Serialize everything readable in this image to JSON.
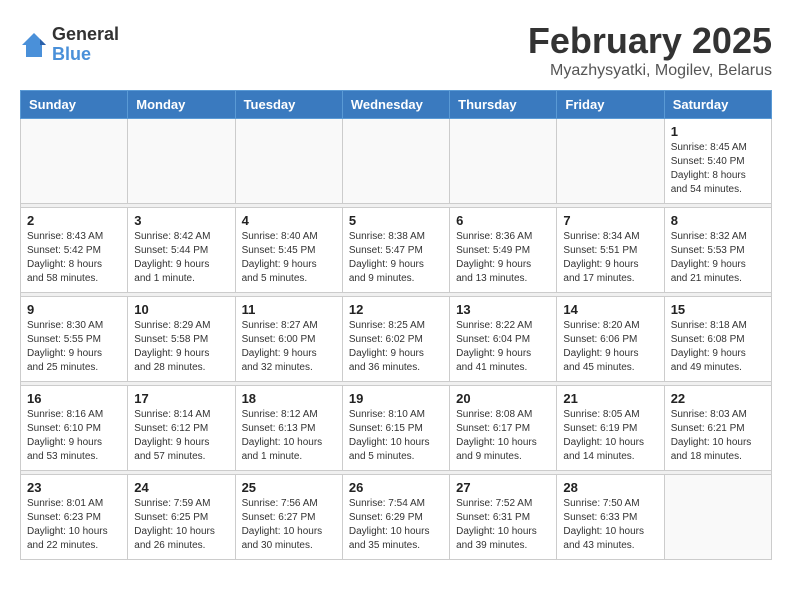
{
  "logo": {
    "general": "General",
    "blue": "Blue"
  },
  "header": {
    "month_title": "February 2025",
    "subtitle": "Myazhysyatki, Mogilev, Belarus"
  },
  "days_of_week": [
    "Sunday",
    "Monday",
    "Tuesday",
    "Wednesday",
    "Thursday",
    "Friday",
    "Saturday"
  ],
  "weeks": [
    [
      {
        "day": "",
        "info": ""
      },
      {
        "day": "",
        "info": ""
      },
      {
        "day": "",
        "info": ""
      },
      {
        "day": "",
        "info": ""
      },
      {
        "day": "",
        "info": ""
      },
      {
        "day": "",
        "info": ""
      },
      {
        "day": "1",
        "info": "Sunrise: 8:45 AM\nSunset: 5:40 PM\nDaylight: 8 hours\nand 54 minutes."
      }
    ],
    [
      {
        "day": "2",
        "info": "Sunrise: 8:43 AM\nSunset: 5:42 PM\nDaylight: 8 hours\nand 58 minutes."
      },
      {
        "day": "3",
        "info": "Sunrise: 8:42 AM\nSunset: 5:44 PM\nDaylight: 9 hours\nand 1 minute."
      },
      {
        "day": "4",
        "info": "Sunrise: 8:40 AM\nSunset: 5:45 PM\nDaylight: 9 hours\nand 5 minutes."
      },
      {
        "day": "5",
        "info": "Sunrise: 8:38 AM\nSunset: 5:47 PM\nDaylight: 9 hours\nand 9 minutes."
      },
      {
        "day": "6",
        "info": "Sunrise: 8:36 AM\nSunset: 5:49 PM\nDaylight: 9 hours\nand 13 minutes."
      },
      {
        "day": "7",
        "info": "Sunrise: 8:34 AM\nSunset: 5:51 PM\nDaylight: 9 hours\nand 17 minutes."
      },
      {
        "day": "8",
        "info": "Sunrise: 8:32 AM\nSunset: 5:53 PM\nDaylight: 9 hours\nand 21 minutes."
      }
    ],
    [
      {
        "day": "9",
        "info": "Sunrise: 8:30 AM\nSunset: 5:55 PM\nDaylight: 9 hours\nand 25 minutes."
      },
      {
        "day": "10",
        "info": "Sunrise: 8:29 AM\nSunset: 5:58 PM\nDaylight: 9 hours\nand 28 minutes."
      },
      {
        "day": "11",
        "info": "Sunrise: 8:27 AM\nSunset: 6:00 PM\nDaylight: 9 hours\nand 32 minutes."
      },
      {
        "day": "12",
        "info": "Sunrise: 8:25 AM\nSunset: 6:02 PM\nDaylight: 9 hours\nand 36 minutes."
      },
      {
        "day": "13",
        "info": "Sunrise: 8:22 AM\nSunset: 6:04 PM\nDaylight: 9 hours\nand 41 minutes."
      },
      {
        "day": "14",
        "info": "Sunrise: 8:20 AM\nSunset: 6:06 PM\nDaylight: 9 hours\nand 45 minutes."
      },
      {
        "day": "15",
        "info": "Sunrise: 8:18 AM\nSunset: 6:08 PM\nDaylight: 9 hours\nand 49 minutes."
      }
    ],
    [
      {
        "day": "16",
        "info": "Sunrise: 8:16 AM\nSunset: 6:10 PM\nDaylight: 9 hours\nand 53 minutes."
      },
      {
        "day": "17",
        "info": "Sunrise: 8:14 AM\nSunset: 6:12 PM\nDaylight: 9 hours\nand 57 minutes."
      },
      {
        "day": "18",
        "info": "Sunrise: 8:12 AM\nSunset: 6:13 PM\nDaylight: 10 hours\nand 1 minute."
      },
      {
        "day": "19",
        "info": "Sunrise: 8:10 AM\nSunset: 6:15 PM\nDaylight: 10 hours\nand 5 minutes."
      },
      {
        "day": "20",
        "info": "Sunrise: 8:08 AM\nSunset: 6:17 PM\nDaylight: 10 hours\nand 9 minutes."
      },
      {
        "day": "21",
        "info": "Sunrise: 8:05 AM\nSunset: 6:19 PM\nDaylight: 10 hours\nand 14 minutes."
      },
      {
        "day": "22",
        "info": "Sunrise: 8:03 AM\nSunset: 6:21 PM\nDaylight: 10 hours\nand 18 minutes."
      }
    ],
    [
      {
        "day": "23",
        "info": "Sunrise: 8:01 AM\nSunset: 6:23 PM\nDaylight: 10 hours\nand 22 minutes."
      },
      {
        "day": "24",
        "info": "Sunrise: 7:59 AM\nSunset: 6:25 PM\nDaylight: 10 hours\nand 26 minutes."
      },
      {
        "day": "25",
        "info": "Sunrise: 7:56 AM\nSunset: 6:27 PM\nDaylight: 10 hours\nand 30 minutes."
      },
      {
        "day": "26",
        "info": "Sunrise: 7:54 AM\nSunset: 6:29 PM\nDaylight: 10 hours\nand 35 minutes."
      },
      {
        "day": "27",
        "info": "Sunrise: 7:52 AM\nSunset: 6:31 PM\nDaylight: 10 hours\nand 39 minutes."
      },
      {
        "day": "28",
        "info": "Sunrise: 7:50 AM\nSunset: 6:33 PM\nDaylight: 10 hours\nand 43 minutes."
      },
      {
        "day": "",
        "info": ""
      }
    ]
  ]
}
